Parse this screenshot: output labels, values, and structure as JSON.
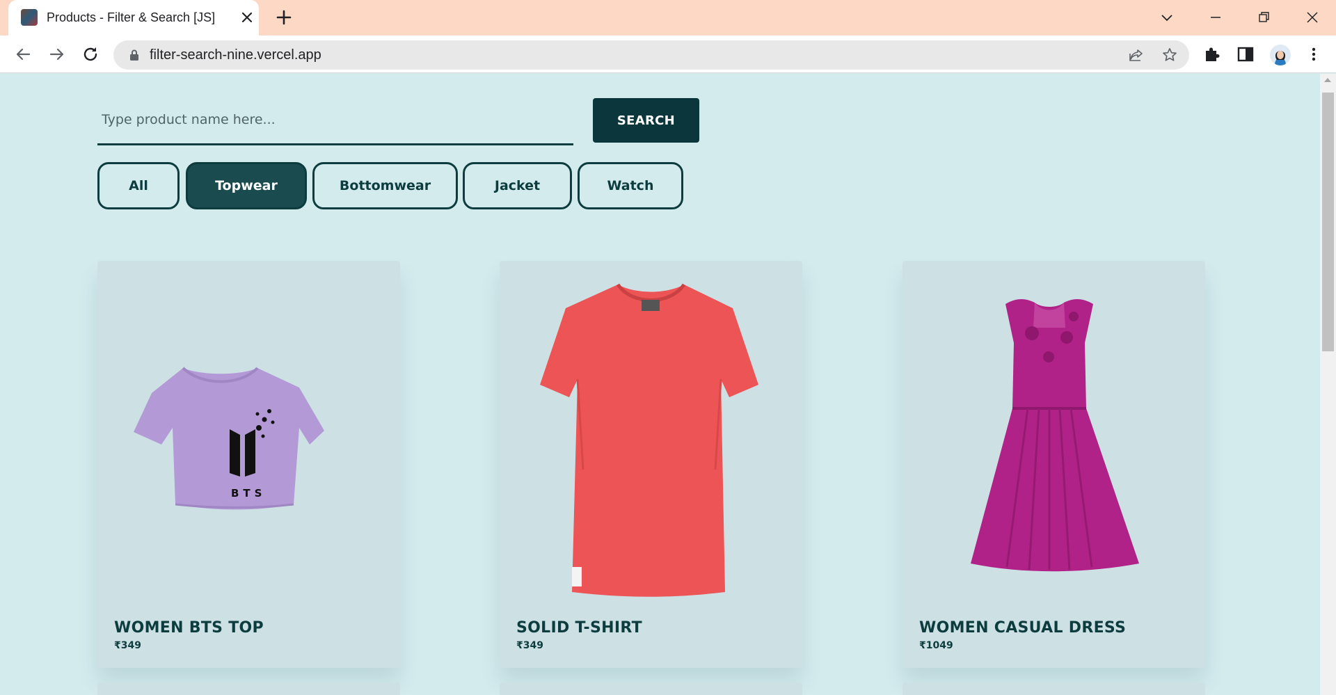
{
  "browser": {
    "tab_title": "Products - Filter & Search [JS]",
    "url": "filter-search-nine.vercel.app"
  },
  "search": {
    "placeholder": "Type product name here...",
    "value": "",
    "button_label": "SEARCH"
  },
  "filters": [
    {
      "label": "All",
      "active": false
    },
    {
      "label": "Topwear",
      "active": true
    },
    {
      "label": "Bottomwear",
      "active": false
    },
    {
      "label": "Jacket",
      "active": false
    },
    {
      "label": "Watch",
      "active": false
    }
  ],
  "products": [
    {
      "name": "WOMEN BTS TOP",
      "price": "₹349",
      "image": "lilac-crop-top-bts-print",
      "print_text": "BTS"
    },
    {
      "name": "SOLID T-SHIRT",
      "price": "₹349",
      "image": "coral-red-tshirt"
    },
    {
      "name": "WOMEN CASUAL DRESS",
      "price": "₹1049",
      "image": "magenta-skater-dress"
    }
  ],
  "colors": {
    "page_bg": "#d4ebee",
    "card_bg": "#cde1e5",
    "accent_dark": "#0b363b",
    "active_filter": "#1a4c4f",
    "tab_strip": "#fcd8c5"
  }
}
